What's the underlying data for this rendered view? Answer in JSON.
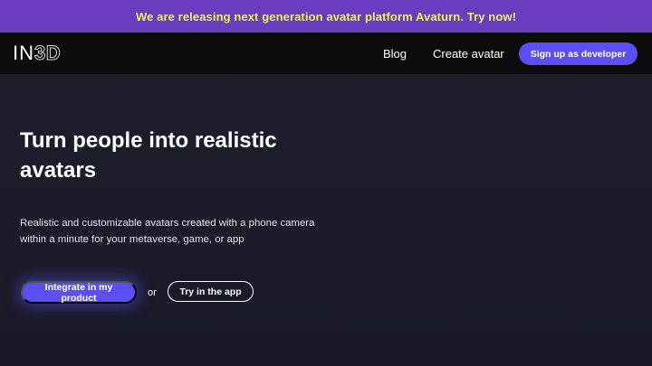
{
  "announcement": {
    "text": "We are releasing next generation avatar platform Avaturn. Try now!",
    "background": "#6a3cbf",
    "text_color": "#e8f26b"
  },
  "nav": {
    "logo": {
      "part1": "IN",
      "part2": "3D"
    },
    "links": [
      "Blog",
      "Create avatar"
    ],
    "cta_label": "Sign up as developer",
    "background": "#0c0c0f"
  },
  "hero": {
    "title": "Turn people into realistic avatars",
    "subtitle": "Realistic and customizable avatars created with a phone camera within a minute for your metaverse, game, or app",
    "primary_button": "Integrate in my product",
    "or_text": "or",
    "secondary_button": "Try in the app"
  },
  "colors": {
    "accent": "#5b4ef3",
    "page_background": "#1e1f2e"
  }
}
